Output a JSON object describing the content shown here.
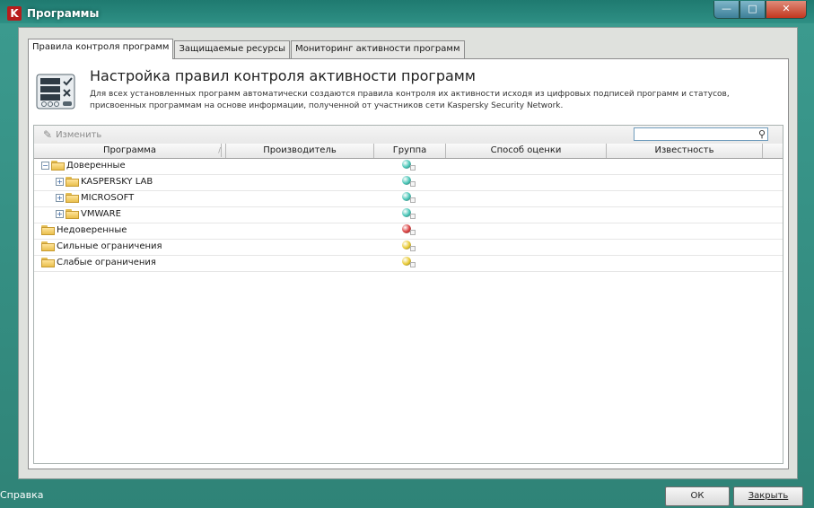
{
  "window": {
    "title": "Программы",
    "icon": "kaspersky-icon",
    "controls": [
      "minimize",
      "maximize",
      "close"
    ]
  },
  "tabs": [
    {
      "label": "Правила контроля программ",
      "active": true
    },
    {
      "label": "Защищаемые ресурсы",
      "active": false
    },
    {
      "label": "Мониторинг активности программ",
      "active": false
    }
  ],
  "header": {
    "title": "Настройка правил контроля активности программ",
    "description": "Для всех установленных программ автоматически создаются правила контроля их активности исходя из цифровых подписей программ и статусов, присвоенных программам на основе информации, полученной от участников сети Kaspersky Security Network."
  },
  "toolbar": {
    "edit_label": "Изменить",
    "search_placeholder": ""
  },
  "table": {
    "columns": [
      "Программа",
      "Производитель",
      "Группа",
      "Способ оценки",
      "Известность"
    ],
    "rows": [
      {
        "name": "Доверенные",
        "level": 0,
        "expand": "minus",
        "group_status": "teal"
      },
      {
        "name": "KASPERSKY LAB",
        "level": 1,
        "expand": "plus",
        "group_status": "teal"
      },
      {
        "name": "MICROSOFT",
        "level": 1,
        "expand": "plus",
        "group_status": "teal"
      },
      {
        "name": "VMWARE",
        "level": 1,
        "expand": "plus",
        "group_status": "teal"
      },
      {
        "name": "Недоверенные",
        "level": 0,
        "expand": "none",
        "group_status": "red"
      },
      {
        "name": "Сильные ограничения",
        "level": 0,
        "expand": "none",
        "group_status": "yellow"
      },
      {
        "name": "Слабые ограничения",
        "level": 0,
        "expand": "none",
        "group_status": "yellow"
      }
    ]
  },
  "footer": {
    "help_label": "Справка",
    "ok_label": "ОК",
    "close_label": "Закрыть"
  },
  "colors": {
    "teal": "#43c4b5",
    "red": "#d93a3a",
    "yellow": "#e8c82c"
  }
}
